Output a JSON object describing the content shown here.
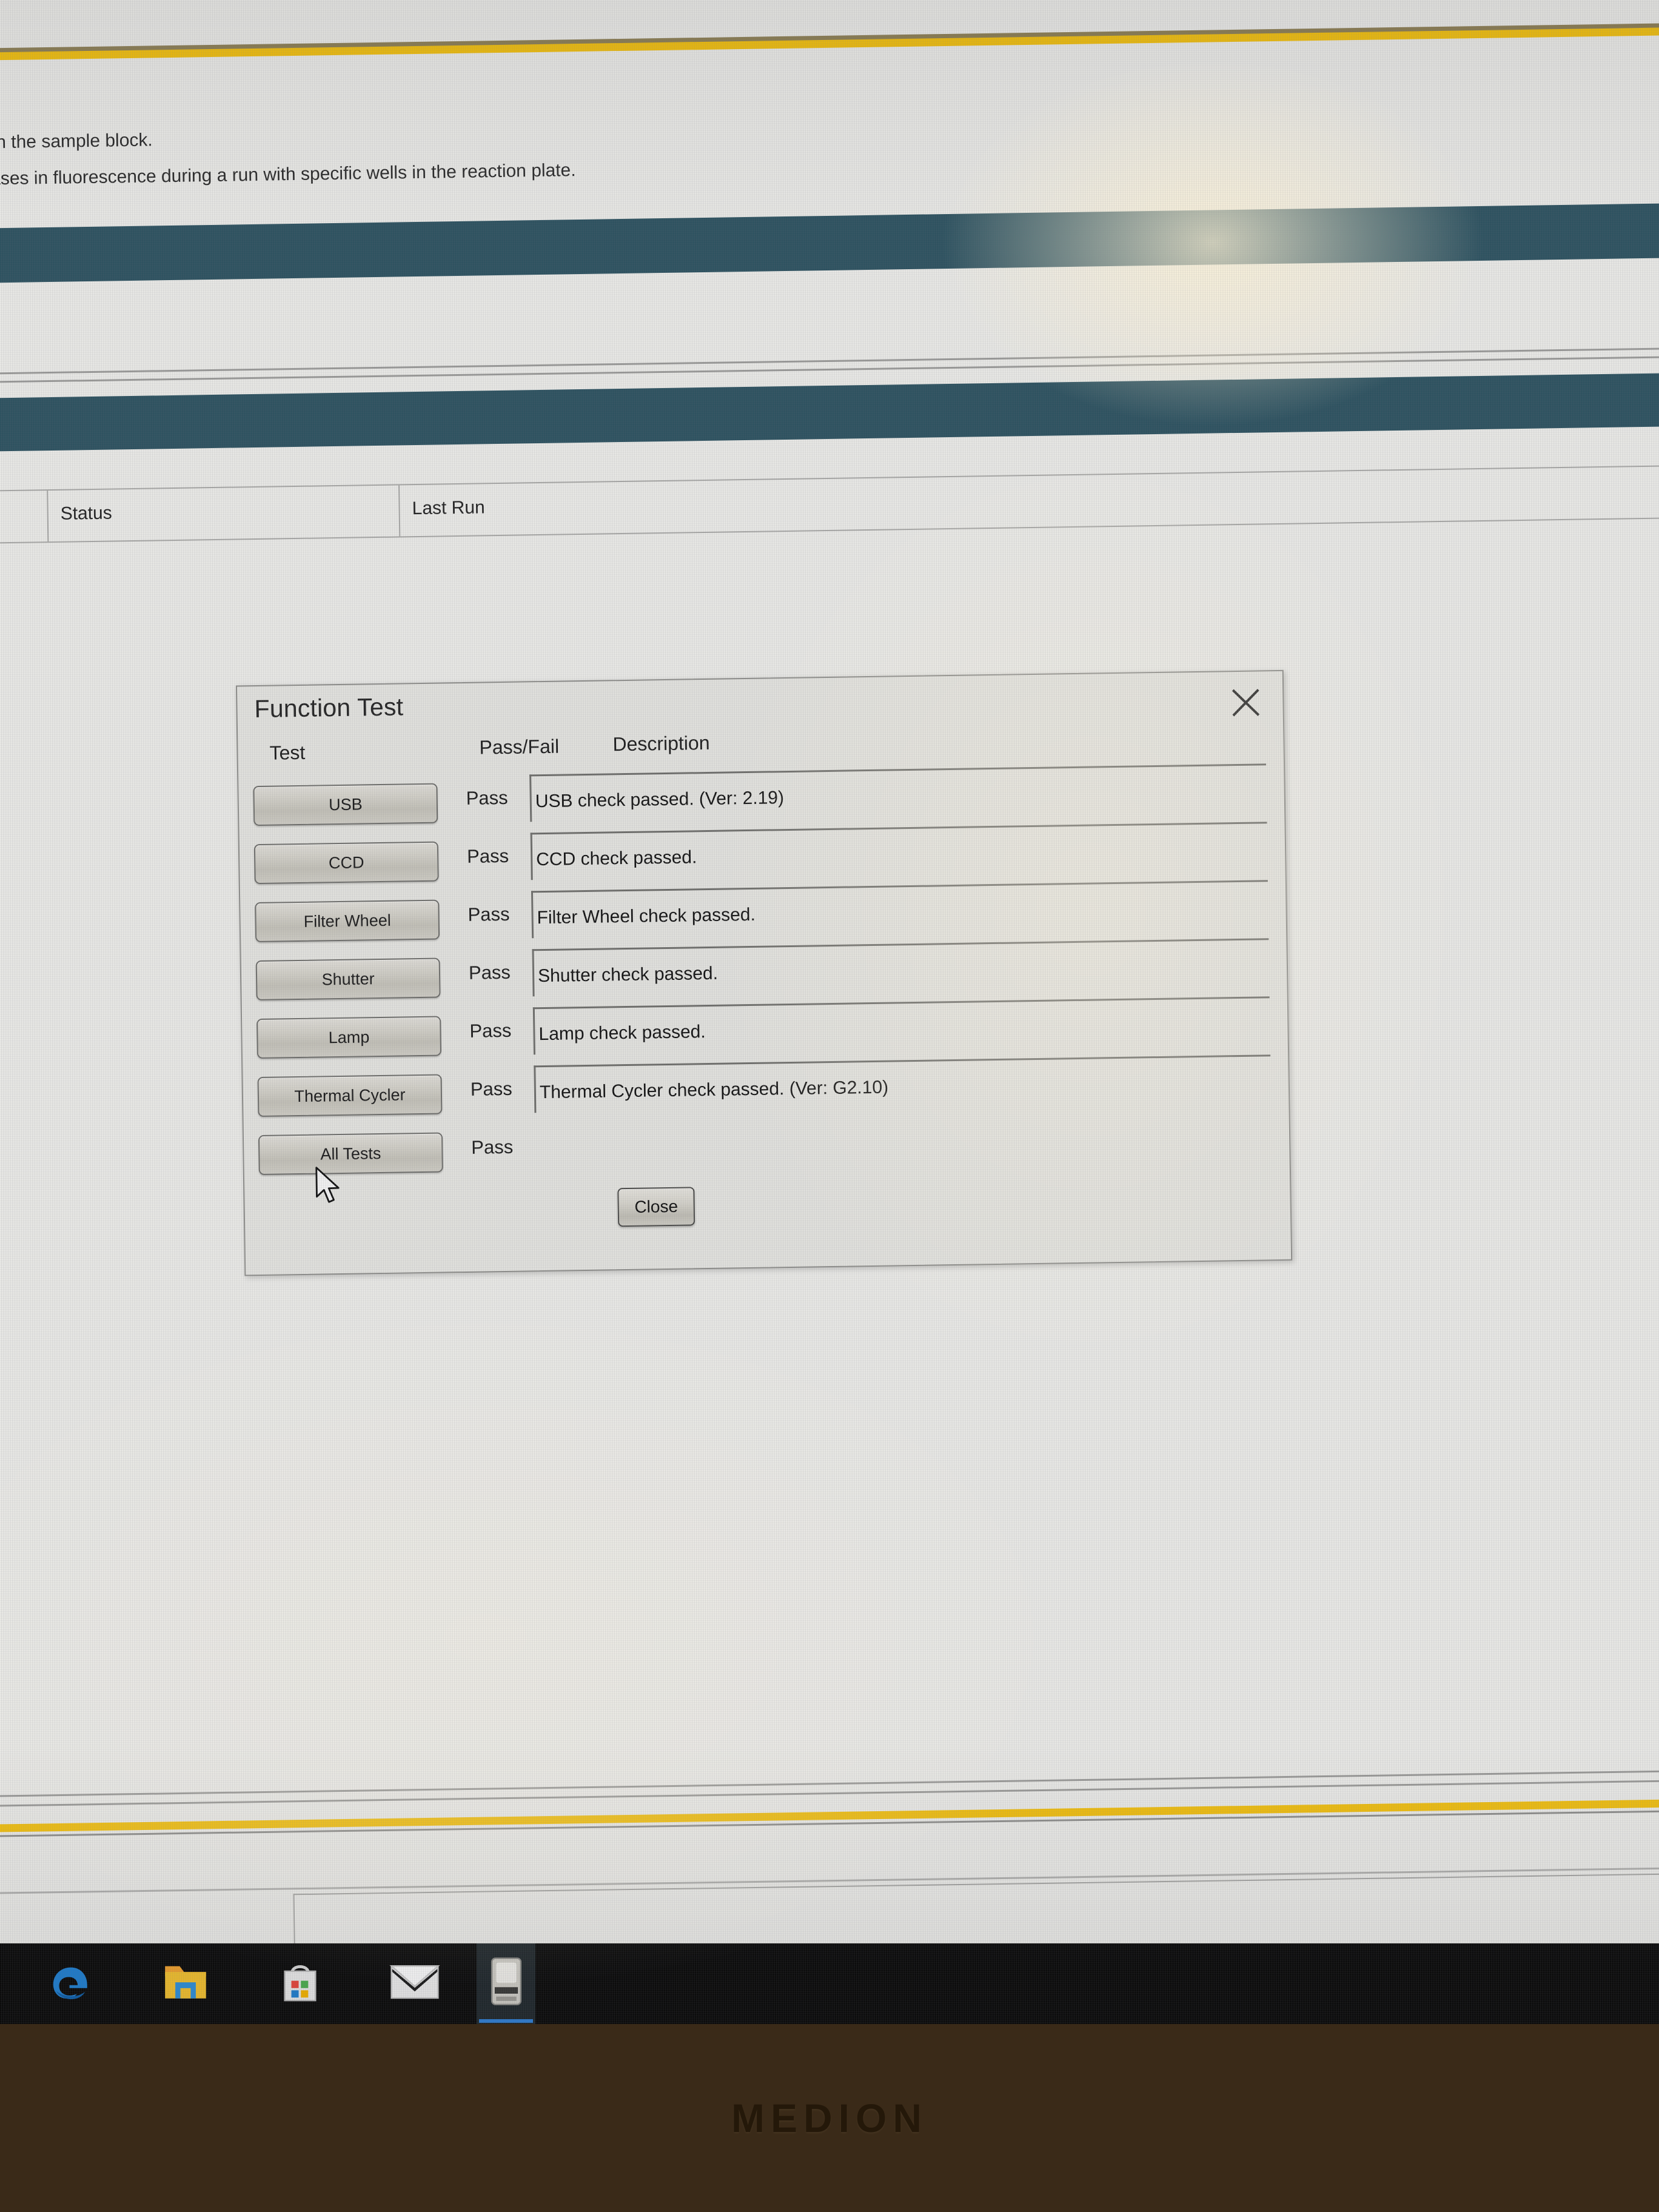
{
  "screen": {
    "help_lines": [
      "ls in the sample block.",
      "reases in fluorescence during a run with specific wells in the reaction plate."
    ],
    "table_header": {
      "status_label": "Status",
      "last_run_label": "Last Run"
    }
  },
  "dialog": {
    "title": "Function Test",
    "close_icon": "close-x-icon",
    "columns": {
      "test": "Test",
      "pass_fail": "Pass/Fail",
      "description": "Description"
    },
    "rows": [
      {
        "test": "USB",
        "result": "Pass",
        "description": "USB check passed. (Ver: 2.19)"
      },
      {
        "test": "CCD",
        "result": "Pass",
        "description": "CCD check passed."
      },
      {
        "test": "Filter Wheel",
        "result": "Pass",
        "description": "Filter Wheel check passed."
      },
      {
        "test": "Shutter",
        "result": "Pass",
        "description": "Shutter check passed."
      },
      {
        "test": "Lamp",
        "result": "Pass",
        "description": "Lamp check passed."
      },
      {
        "test": "Thermal Cycler",
        "result": "Pass",
        "description": "Thermal Cycler check passed. (Ver: G2.10)"
      },
      {
        "test": "All Tests",
        "result": "Pass",
        "description": ""
      }
    ],
    "close_button": "Close"
  },
  "taskbar": {
    "items": [
      {
        "name": "edge-icon",
        "active": false
      },
      {
        "name": "file-explorer-icon",
        "active": false
      },
      {
        "name": "microsoft-store-icon",
        "active": false
      },
      {
        "name": "mail-icon",
        "active": false
      },
      {
        "name": "instrument-app-icon",
        "active": true
      }
    ]
  },
  "monitor": {
    "brand": "MEDION"
  },
  "colors": {
    "accent_yellow": "#efbe12",
    "band_teal": "#2d5260",
    "dialog_bg": "#e2e2de",
    "screen_bg": "#e9e9e6",
    "taskbar_bg": "#0b0b0b",
    "active_tab_underline": "#2f7fd4"
  }
}
